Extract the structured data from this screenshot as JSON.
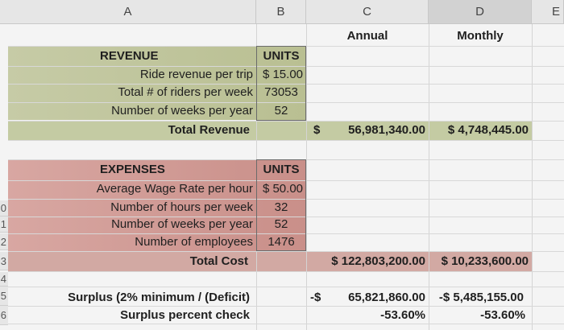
{
  "columns": {
    "a": "A",
    "b": "B",
    "c": "C",
    "d": "D",
    "e": "E"
  },
  "rows": {
    "r10": "0",
    "r11": "1",
    "r12": "2",
    "r13": "3",
    "r14": "4",
    "r15": "5",
    "r16": "6"
  },
  "headings": {
    "annual": "Annual",
    "monthly": "Monthly"
  },
  "revenue": {
    "title": "REVENUE",
    "units": "UNITS",
    "items": [
      {
        "label": "Ride revenue per trip",
        "value": "$ 15.00"
      },
      {
        "label": "Total # of riders per week",
        "value": "73053"
      },
      {
        "label": "Number of weeks per year",
        "value": "52"
      }
    ],
    "total_label": "Total Revenue",
    "total_dollar": "$",
    "total_annual": "56,981,340.00",
    "total_monthly": "$ 4,748,445.00"
  },
  "expenses": {
    "title": "EXPENSES",
    "units": "UNITS",
    "items": [
      {
        "label": "Average Wage Rate per hour",
        "value": "$ 50.00"
      },
      {
        "label": "Number of hours per week",
        "value": "32"
      },
      {
        "label": "Number of weeks per year",
        "value": "52"
      },
      {
        "label": "Number of employees",
        "value": "1476"
      }
    ],
    "total_label": "Total Cost",
    "total_annual": "$ 122,803,200.00",
    "total_monthly": "$ 10,233,600.00"
  },
  "surplus": {
    "label": "Surplus (2% minimum / (Deficit)",
    "sign": "-$",
    "annual": "65,821,860.00",
    "monthly": "-$ 5,485,155.00",
    "check_label": "Surplus percent check",
    "check_annual": "-53.60%",
    "check_monthly": "-53.60%"
  }
}
